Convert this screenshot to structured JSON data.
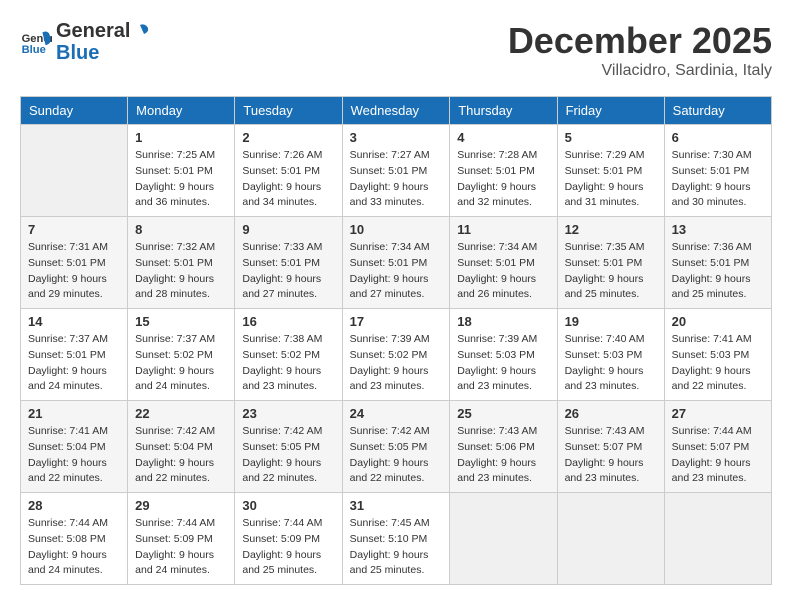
{
  "header": {
    "logo_general": "General",
    "logo_blue": "Blue",
    "month": "December 2025",
    "location": "Villacidro, Sardinia, Italy"
  },
  "days_of_week": [
    "Sunday",
    "Monday",
    "Tuesday",
    "Wednesday",
    "Thursday",
    "Friday",
    "Saturday"
  ],
  "weeks": [
    [
      {
        "day": "",
        "sunrise": "",
        "sunset": "",
        "daylight": "",
        "empty": true
      },
      {
        "day": "1",
        "sunrise": "Sunrise: 7:25 AM",
        "sunset": "Sunset: 5:01 PM",
        "daylight": "Daylight: 9 hours and 36 minutes."
      },
      {
        "day": "2",
        "sunrise": "Sunrise: 7:26 AM",
        "sunset": "Sunset: 5:01 PM",
        "daylight": "Daylight: 9 hours and 34 minutes."
      },
      {
        "day": "3",
        "sunrise": "Sunrise: 7:27 AM",
        "sunset": "Sunset: 5:01 PM",
        "daylight": "Daylight: 9 hours and 33 minutes."
      },
      {
        "day": "4",
        "sunrise": "Sunrise: 7:28 AM",
        "sunset": "Sunset: 5:01 PM",
        "daylight": "Daylight: 9 hours and 32 minutes."
      },
      {
        "day": "5",
        "sunrise": "Sunrise: 7:29 AM",
        "sunset": "Sunset: 5:01 PM",
        "daylight": "Daylight: 9 hours and 31 minutes."
      },
      {
        "day": "6",
        "sunrise": "Sunrise: 7:30 AM",
        "sunset": "Sunset: 5:01 PM",
        "daylight": "Daylight: 9 hours and 30 minutes."
      }
    ],
    [
      {
        "day": "7",
        "sunrise": "Sunrise: 7:31 AM",
        "sunset": "Sunset: 5:01 PM",
        "daylight": "Daylight: 9 hours and 29 minutes."
      },
      {
        "day": "8",
        "sunrise": "Sunrise: 7:32 AM",
        "sunset": "Sunset: 5:01 PM",
        "daylight": "Daylight: 9 hours and 28 minutes."
      },
      {
        "day": "9",
        "sunrise": "Sunrise: 7:33 AM",
        "sunset": "Sunset: 5:01 PM",
        "daylight": "Daylight: 9 hours and 27 minutes."
      },
      {
        "day": "10",
        "sunrise": "Sunrise: 7:34 AM",
        "sunset": "Sunset: 5:01 PM",
        "daylight": "Daylight: 9 hours and 27 minutes."
      },
      {
        "day": "11",
        "sunrise": "Sunrise: 7:34 AM",
        "sunset": "Sunset: 5:01 PM",
        "daylight": "Daylight: 9 hours and 26 minutes."
      },
      {
        "day": "12",
        "sunrise": "Sunrise: 7:35 AM",
        "sunset": "Sunset: 5:01 PM",
        "daylight": "Daylight: 9 hours and 25 minutes."
      },
      {
        "day": "13",
        "sunrise": "Sunrise: 7:36 AM",
        "sunset": "Sunset: 5:01 PM",
        "daylight": "Daylight: 9 hours and 25 minutes."
      }
    ],
    [
      {
        "day": "14",
        "sunrise": "Sunrise: 7:37 AM",
        "sunset": "Sunset: 5:01 PM",
        "daylight": "Daylight: 9 hours and 24 minutes."
      },
      {
        "day": "15",
        "sunrise": "Sunrise: 7:37 AM",
        "sunset": "Sunset: 5:02 PM",
        "daylight": "Daylight: 9 hours and 24 minutes."
      },
      {
        "day": "16",
        "sunrise": "Sunrise: 7:38 AM",
        "sunset": "Sunset: 5:02 PM",
        "daylight": "Daylight: 9 hours and 23 minutes."
      },
      {
        "day": "17",
        "sunrise": "Sunrise: 7:39 AM",
        "sunset": "Sunset: 5:02 PM",
        "daylight": "Daylight: 9 hours and 23 minutes."
      },
      {
        "day": "18",
        "sunrise": "Sunrise: 7:39 AM",
        "sunset": "Sunset: 5:03 PM",
        "daylight": "Daylight: 9 hours and 23 minutes."
      },
      {
        "day": "19",
        "sunrise": "Sunrise: 7:40 AM",
        "sunset": "Sunset: 5:03 PM",
        "daylight": "Daylight: 9 hours and 23 minutes."
      },
      {
        "day": "20",
        "sunrise": "Sunrise: 7:41 AM",
        "sunset": "Sunset: 5:03 PM",
        "daylight": "Daylight: 9 hours and 22 minutes."
      }
    ],
    [
      {
        "day": "21",
        "sunrise": "Sunrise: 7:41 AM",
        "sunset": "Sunset: 5:04 PM",
        "daylight": "Daylight: 9 hours and 22 minutes."
      },
      {
        "day": "22",
        "sunrise": "Sunrise: 7:42 AM",
        "sunset": "Sunset: 5:04 PM",
        "daylight": "Daylight: 9 hours and 22 minutes."
      },
      {
        "day": "23",
        "sunrise": "Sunrise: 7:42 AM",
        "sunset": "Sunset: 5:05 PM",
        "daylight": "Daylight: 9 hours and 22 minutes."
      },
      {
        "day": "24",
        "sunrise": "Sunrise: 7:42 AM",
        "sunset": "Sunset: 5:05 PM",
        "daylight": "Daylight: 9 hours and 22 minutes."
      },
      {
        "day": "25",
        "sunrise": "Sunrise: 7:43 AM",
        "sunset": "Sunset: 5:06 PM",
        "daylight": "Daylight: 9 hours and 23 minutes."
      },
      {
        "day": "26",
        "sunrise": "Sunrise: 7:43 AM",
        "sunset": "Sunset: 5:07 PM",
        "daylight": "Daylight: 9 hours and 23 minutes."
      },
      {
        "day": "27",
        "sunrise": "Sunrise: 7:44 AM",
        "sunset": "Sunset: 5:07 PM",
        "daylight": "Daylight: 9 hours and 23 minutes."
      }
    ],
    [
      {
        "day": "28",
        "sunrise": "Sunrise: 7:44 AM",
        "sunset": "Sunset: 5:08 PM",
        "daylight": "Daylight: 9 hours and 24 minutes."
      },
      {
        "day": "29",
        "sunrise": "Sunrise: 7:44 AM",
        "sunset": "Sunset: 5:09 PM",
        "daylight": "Daylight: 9 hours and 24 minutes."
      },
      {
        "day": "30",
        "sunrise": "Sunrise: 7:44 AM",
        "sunset": "Sunset: 5:09 PM",
        "daylight": "Daylight: 9 hours and 25 minutes."
      },
      {
        "day": "31",
        "sunrise": "Sunrise: 7:45 AM",
        "sunset": "Sunset: 5:10 PM",
        "daylight": "Daylight: 9 hours and 25 minutes."
      },
      {
        "day": "",
        "sunrise": "",
        "sunset": "",
        "daylight": "",
        "empty": true
      },
      {
        "day": "",
        "sunrise": "",
        "sunset": "",
        "daylight": "",
        "empty": true
      },
      {
        "day": "",
        "sunrise": "",
        "sunset": "",
        "daylight": "",
        "empty": true
      }
    ]
  ]
}
